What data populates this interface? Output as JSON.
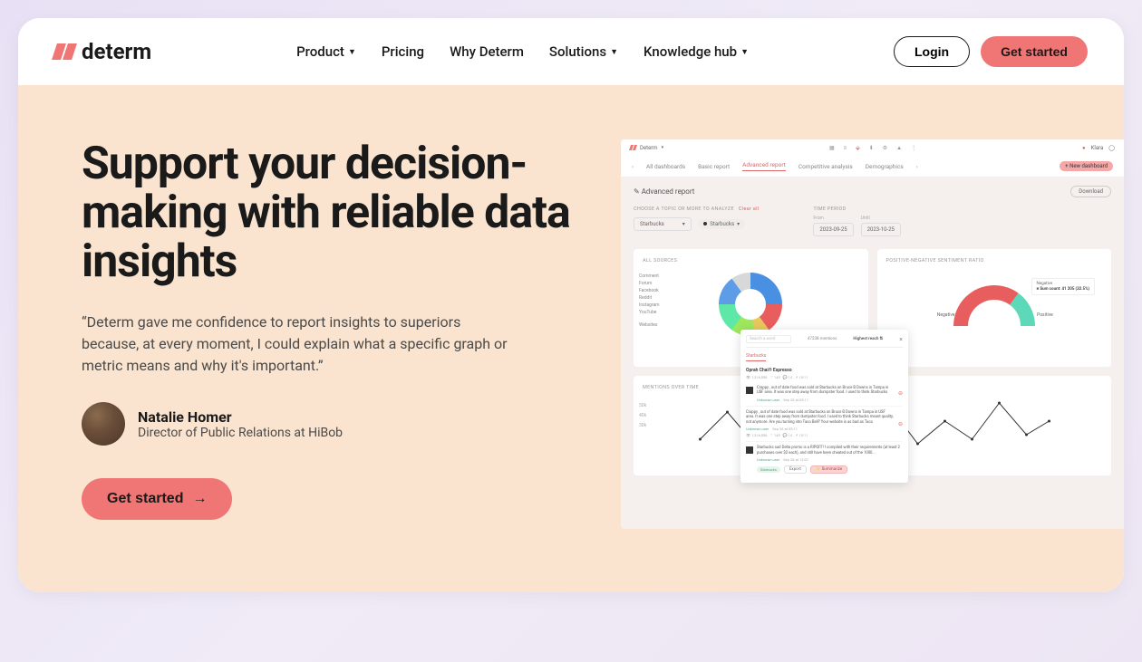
{
  "brand": "determ",
  "nav": {
    "product": "Product",
    "pricing": "Pricing",
    "why": "Why Determ",
    "solutions": "Solutions",
    "knowledge": "Knowledge hub"
  },
  "header": {
    "login": "Login",
    "getstarted": "Get started"
  },
  "hero": {
    "title": "Support your decision-making with reliable data insights",
    "quote": "“Determ gave me confidence to report insights to superiors because, at every moment, I could explain what a specific graph or metric means and why it's important.”",
    "author_name": "Natalie Homer",
    "author_role": "Director of Public Relations at HiBob",
    "cta": "Get started"
  },
  "dashboard": {
    "brand": "Determ",
    "user": "Klara",
    "tabs": {
      "all": "All dashboards",
      "basic": "Basic report",
      "advanced": "Advanced report",
      "competitive": "Competitive analysis",
      "demographics": "Demographics"
    },
    "new_dashboard": "+ New dashboard",
    "report_title": "Advanced report",
    "download": "Download",
    "topic_label": "CHOOSE A TOPIC OR MORE TO ANALYZE",
    "clear": "Clear all",
    "topic_value": "Starbucks",
    "chip_value": "Starbucks",
    "period_label": "TIME PERIOD",
    "from_label": "From",
    "to_label": "Until",
    "from": "2023-09-25",
    "to": "2023-10-25",
    "sources_title": "ALL SOURCES",
    "sources": {
      "comment": "Comment",
      "forum": "Forum",
      "facebook": "Facebook",
      "reddit": "Reddit",
      "instagram": "Instagram",
      "youtube": "YouTube",
      "websites": "Websites"
    },
    "sentiment_title": "POSITIVE-NEGATIVE SENTIMENT RATIO",
    "negative": "Negative",
    "positive": "Positive",
    "tooltip_label": "Negative",
    "tooltip_value": "Sum count: 41 205 (32.5%)",
    "mentions_title": "MENTIONS OVER TIME",
    "y50": "50k",
    "y40": "40k",
    "y30": "30k"
  },
  "popup": {
    "search_ph": "Search a word",
    "count": "47238 mentions",
    "sort": "Highest reach",
    "tab": "Starbucks",
    "row1": "Oprah Chai® Espresso",
    "item1_text": "Crappy , out of date food was sold at Starbucks on Bruce B Downs in Tampa in USF area. It was one step away from dumpster food. I used to think Starbucks",
    "item1_user": "Unknown user",
    "item1_date": "Sep 28 at 05:11",
    "item2_text": "Crappy , out of date food was sold at Starbucks on Bruce B Downs in Tampa in USF area. It was one step away from dumpster food. I used to think Starbucks meant quality, not anymore. Are you turning into Taco Bell? Your website is as bad as Taco",
    "item2_user": "Unknown user",
    "item2_date": "Sep 28 at 05:11",
    "item3_text": "Starbucks sad Delta promo is a RIPOFF! I complied with their requirements (at least 2 purchases over $2 each), and still have been cheated out of the 1000...",
    "item3_user": "Unknown user",
    "item3_date": "Sep 28 at 12:07",
    "tag": "Starbucks",
    "export": "Export",
    "summarize": "✨ Summarize"
  }
}
